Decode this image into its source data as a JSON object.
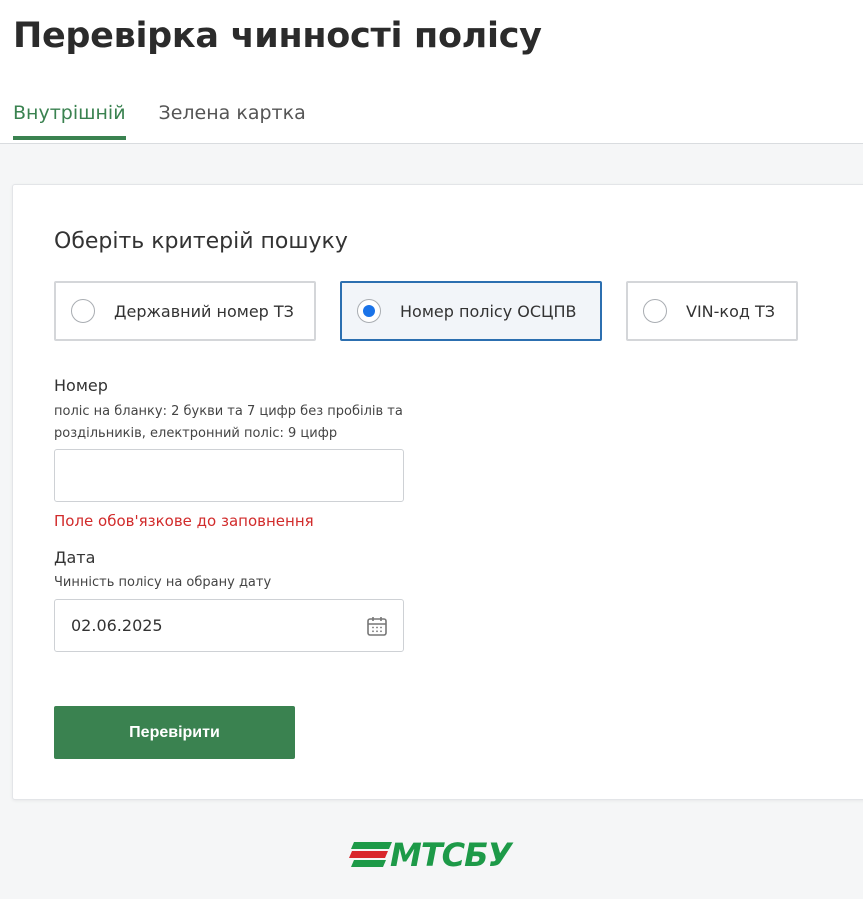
{
  "page": {
    "title": "Перевірка чинності полісу"
  },
  "tabs": [
    {
      "label": "Внутрішній",
      "active": true
    },
    {
      "label": "Зелена картка",
      "active": false
    }
  ],
  "form": {
    "criteria_title": "Оберіть критерій пошуку",
    "options": [
      {
        "label": "Державний номер ТЗ",
        "selected": false
      },
      {
        "label": "Номер полісу ОСЦПВ",
        "selected": true
      },
      {
        "label": "VIN-код ТЗ",
        "selected": false
      }
    ],
    "number": {
      "label": "Номер",
      "hint_line1": "поліс на бланку: 2 букви та 7 цифр без пробілів та",
      "hint_line2": "роздільників, електронний поліс: 9 цифр",
      "value": "",
      "error": "Поле обов'язкове до заповнення"
    },
    "date": {
      "label": "Дата",
      "hint": "Чинність полісу на обрану дату",
      "value": "02.06.2025",
      "icon": "calendar-icon"
    },
    "submit_label": "Перевірити"
  },
  "footer": {
    "logo_text": "МТСБУ"
  },
  "colors": {
    "accent": "#3a8250",
    "selected_border": "#2c6fb0",
    "error": "#d12b2b",
    "logo": "#1d9a48"
  }
}
